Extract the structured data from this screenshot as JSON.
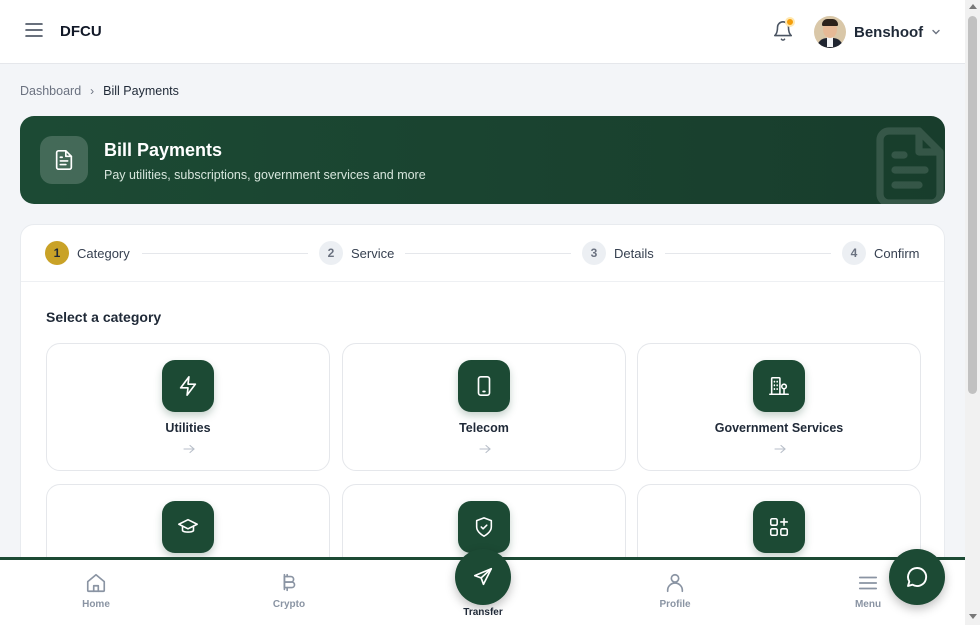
{
  "header": {
    "brand": "DFCU",
    "user_name": "Benshoof",
    "menu_icon": "hamburger-icon",
    "notification_icon": "bell-icon",
    "notification_dot_color": "#f59e0b"
  },
  "breadcrumb": {
    "items": [
      "Dashboard",
      "Bill Payments"
    ]
  },
  "hero": {
    "title": "Bill Payments",
    "subtitle": "Pay utilities, subscriptions, government services and more",
    "icon": "document-icon",
    "background_color": "#1c4a34"
  },
  "stepper": {
    "steps": [
      {
        "number": "1",
        "label": "Category",
        "active": true
      },
      {
        "number": "2",
        "label": "Service",
        "active": false
      },
      {
        "number": "3",
        "label": "Details",
        "active": false
      },
      {
        "number": "4",
        "label": "Confirm",
        "active": false
      }
    ],
    "active_color": "#c9a227"
  },
  "category_section": {
    "title": "Select a category",
    "categories": [
      {
        "label": "Utilities",
        "icon": "lightning-icon"
      },
      {
        "label": "Telecom",
        "icon": "phone-icon"
      },
      {
        "label": "Government Services",
        "icon": "building-icon"
      },
      {
        "label": "",
        "icon": "graduation-cap-icon"
      },
      {
        "label": "",
        "icon": "shield-icon"
      },
      {
        "label": "",
        "icon": "apps-add-icon"
      }
    ]
  },
  "bottom_nav": {
    "items": [
      {
        "label": "Home",
        "icon": "home-icon"
      },
      {
        "label": "Crypto",
        "icon": "bitcoin-icon"
      },
      {
        "label": "Transfer",
        "icon": "send-icon"
      },
      {
        "label": "Profile",
        "icon": "user-icon"
      },
      {
        "label": "Menu",
        "icon": "menu-icon"
      }
    ],
    "chat_icon": "chat-bubble-icon"
  },
  "colors": {
    "brand_green": "#1c4a34",
    "accent_gold": "#c9a227",
    "page_bg": "#f3f5f8"
  }
}
